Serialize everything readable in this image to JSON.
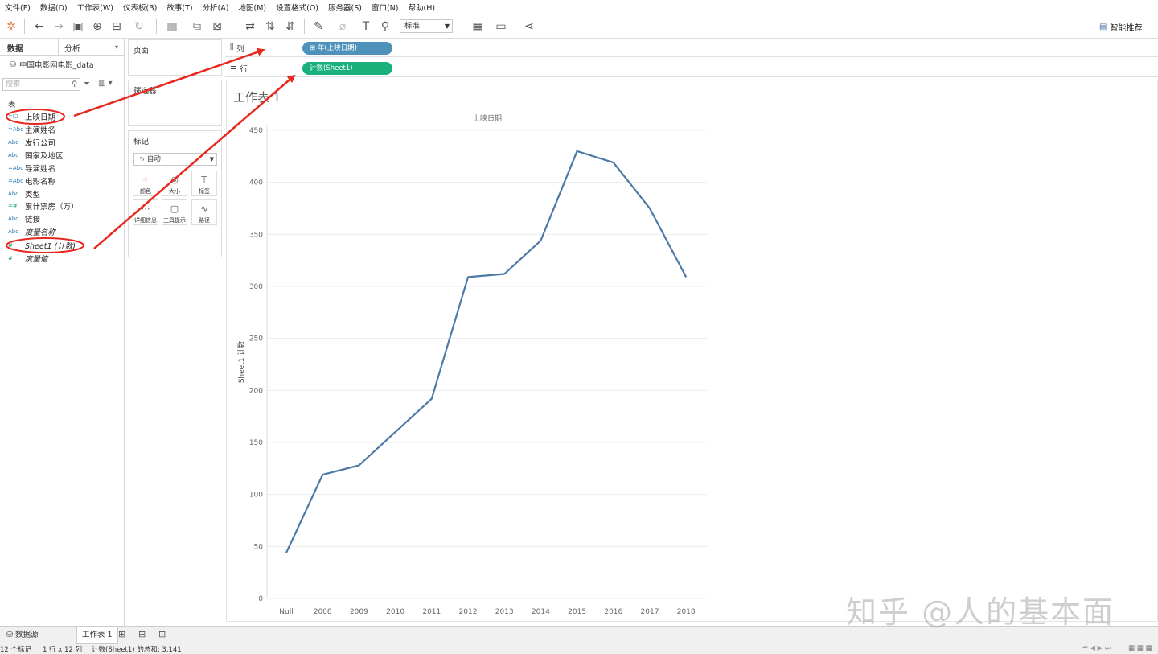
{
  "menu": [
    "文件(F)",
    "数据(D)",
    "工作表(W)",
    "仪表板(B)",
    "故事(T)",
    "分析(A)",
    "地图(M)",
    "设置格式(O)",
    "服务器(S)",
    "窗口(N)",
    "帮助(H)"
  ],
  "toolbar": {
    "fit_value": "标准",
    "smart_label": "智能推荐"
  },
  "data_pane": {
    "tab_data": "数据",
    "tab_analysis": "分析",
    "datasource": "中国电影网电影_data",
    "search_placeholder": "搜索",
    "tables_label": "表",
    "fields": [
      {
        "icon": "=☐",
        "name": "上映日期"
      },
      {
        "icon": "=Abc",
        "name": "主演姓名"
      },
      {
        "icon": "Abc",
        "name": "发行公司"
      },
      {
        "icon": "Abc",
        "name": "国家及地区"
      },
      {
        "icon": "=Abc",
        "name": "导演姓名"
      },
      {
        "icon": "=Abc",
        "name": "电影名称"
      },
      {
        "icon": "Abc",
        "name": "类型"
      },
      {
        "icon": "=#",
        "name": "累计票房（万）"
      },
      {
        "icon": "Abc",
        "name": "链接"
      },
      {
        "icon": "Abc",
        "name": "度量名称"
      },
      {
        "icon": "#",
        "name": "Sheet1 (计数)"
      },
      {
        "icon": "#",
        "name": "度量值"
      }
    ]
  },
  "cards": {
    "pages": "页面",
    "filters": "筛选器",
    "marks": "标记",
    "marks_type": "自动",
    "mark_buttons": [
      "颜色",
      "大小",
      "标签",
      "详细信息",
      "工具提示",
      "路径"
    ]
  },
  "shelves": {
    "cols_label": "列",
    "rows_label": "行",
    "cols_pill": "年(上映日期)",
    "rows_pill": "计数(Sheet1)"
  },
  "sheet": {
    "title": "工作表 1"
  },
  "chart_data": {
    "type": "line",
    "title": "上映日期",
    "ylabel": "Sheet1 计数",
    "xlabel": "",
    "categories": [
      "Null",
      "2008",
      "2009",
      "2010",
      "2011",
      "2012",
      "2013",
      "2014",
      "2015",
      "2016",
      "2017",
      "2018"
    ],
    "values": [
      44,
      119,
      128,
      160,
      192,
      309,
      312,
      344,
      430,
      419,
      375,
      309
    ],
    "ylim": [
      0,
      450
    ],
    "yticks": [
      0,
      50,
      100,
      150,
      200,
      250,
      300,
      350,
      400,
      450
    ],
    "grid": true,
    "line_color": "#4e79a7"
  },
  "bottom": {
    "datasource_tab": "数据源",
    "sheet_tab": "工作表 1",
    "status_marks": "12 个标记",
    "status_dims": "1 行 x 12 列",
    "status_sum": "计数(Sheet1) 的总和: 3,141"
  },
  "watermark": "知乎 @人的基本面"
}
